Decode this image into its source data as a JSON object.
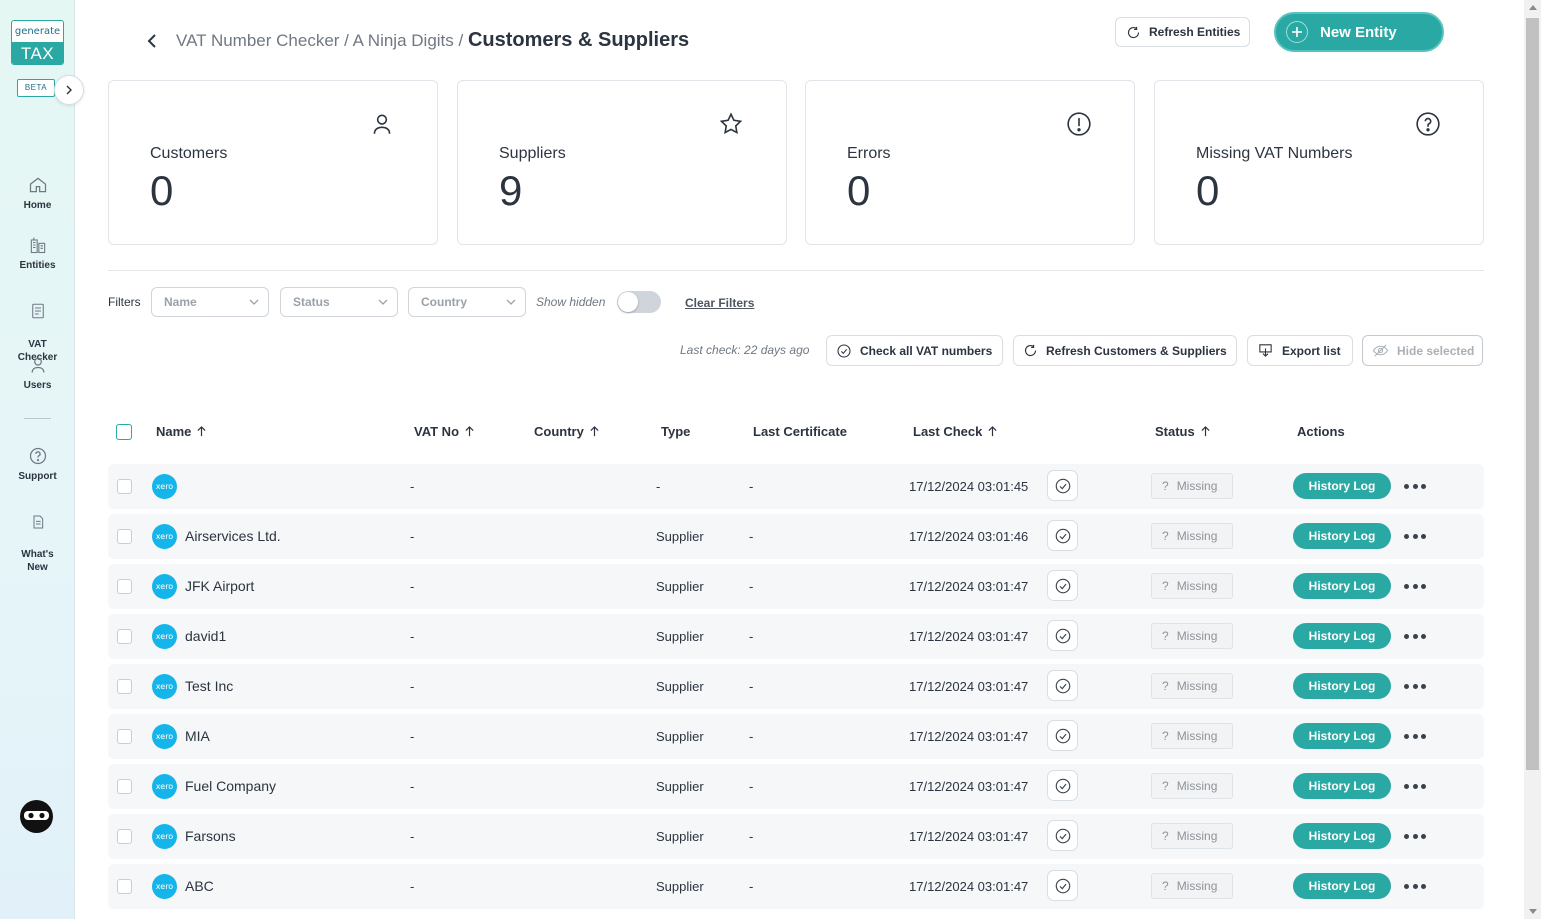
{
  "brand": {
    "logo_top": "generate",
    "logo_bottom": "TAX",
    "beta": "BETA"
  },
  "sidebar": {
    "items": [
      {
        "label": "Home",
        "icon": "home-icon"
      },
      {
        "label": "Entities",
        "icon": "buildings-icon"
      },
      {
        "label": "VAT\nChecker",
        "icon": "document-icon"
      },
      {
        "label": "Users",
        "icon": "user-icon"
      },
      {
        "label": "Support",
        "icon": "help-circle-icon"
      },
      {
        "label": "What's\nNew",
        "icon": "document-icon"
      }
    ]
  },
  "header": {
    "breadcrumb_prefix": "VAT Number Checker / A Ninja Digits / ",
    "breadcrumb_current": "Customers & Suppliers",
    "refresh_entities": "Refresh Entities",
    "new_entity": "New Entity"
  },
  "stats": [
    {
      "label": "Customers",
      "value": "0",
      "icon": "user-icon"
    },
    {
      "label": "Suppliers",
      "value": "9",
      "icon": "star-icon"
    },
    {
      "label": "Errors",
      "value": "0",
      "icon": "alert-circle-icon"
    },
    {
      "label": "Missing VAT Numbers",
      "value": "0",
      "icon": "question-circle-icon"
    }
  ],
  "filters": {
    "label": "Filters",
    "name_placeholder": "Name",
    "status_placeholder": "Status",
    "country_placeholder": "Country",
    "show_hidden": "Show hidden",
    "show_hidden_on": false,
    "clear": "Clear Filters"
  },
  "actions": {
    "last_check": "Last check: 22 days ago",
    "check_all": "Check all VAT numbers",
    "refresh_cs": "Refresh Customers & Suppliers",
    "export": "Export list",
    "hide_selected": "Hide selected"
  },
  "table": {
    "columns": {
      "name": "Name",
      "vat_no": "VAT No",
      "country": "Country",
      "type": "Type",
      "last_certificate": "Last Certificate",
      "last_check": "Last Check",
      "status": "Status",
      "actions": "Actions"
    },
    "xero_badge": "xero",
    "history_label": "History Log",
    "rows": [
      {
        "name": "",
        "vat": "-",
        "type": "-",
        "cert": "-",
        "last_check": "17/12/2024 03:01:45",
        "status": "Missing"
      },
      {
        "name": "Airservices Ltd.",
        "vat": "-",
        "type": "Supplier",
        "cert": "-",
        "last_check": "17/12/2024 03:01:46",
        "status": "Missing"
      },
      {
        "name": "JFK Airport",
        "vat": "-",
        "type": "Supplier",
        "cert": "-",
        "last_check": "17/12/2024 03:01:47",
        "status": "Missing"
      },
      {
        "name": "david1",
        "vat": "-",
        "type": "Supplier",
        "cert": "-",
        "last_check": "17/12/2024 03:01:47",
        "status": "Missing"
      },
      {
        "name": "Test Inc",
        "vat": "-",
        "type": "Supplier",
        "cert": "-",
        "last_check": "17/12/2024 03:01:47",
        "status": "Missing"
      },
      {
        "name": "MIA",
        "vat": "-",
        "type": "Supplier",
        "cert": "-",
        "last_check": "17/12/2024 03:01:47",
        "status": "Missing"
      },
      {
        "name": "Fuel Company",
        "vat": "-",
        "type": "Supplier",
        "cert": "-",
        "last_check": "17/12/2024 03:01:47",
        "status": "Missing"
      },
      {
        "name": "Farsons",
        "vat": "-",
        "type": "Supplier",
        "cert": "-",
        "last_check": "17/12/2024 03:01:47",
        "status": "Missing"
      },
      {
        "name": "ABC",
        "vat": "-",
        "type": "Supplier",
        "cert": "-",
        "last_check": "17/12/2024 03:01:47",
        "status": "Missing"
      }
    ]
  },
  "colors": {
    "accent": "#2aa8a4",
    "xero": "#13b5ea",
    "text": "#2c3440"
  }
}
